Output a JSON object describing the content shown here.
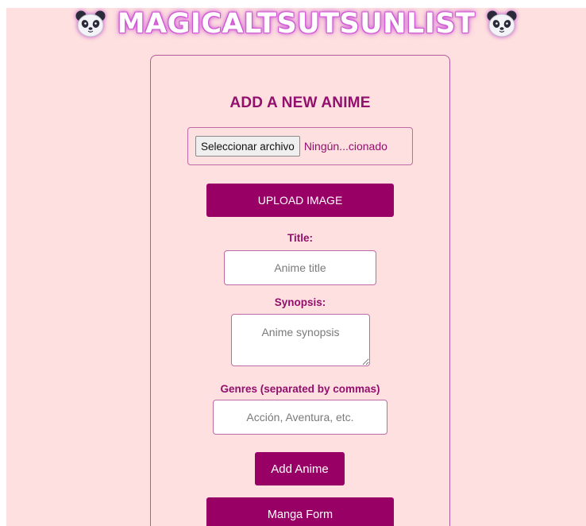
{
  "header": {
    "title": "MAGICALTSUTSUNLIST",
    "left_icon": "panda-icon",
    "right_icon": "panda-icon"
  },
  "form": {
    "heading": "ADD A NEW ANIME",
    "file_input": {
      "button_label": "Seleccionar archivo",
      "status": "Ningún...cionado"
    },
    "upload_label": "UPLOAD IMAGE",
    "title_label": "Title:",
    "title_placeholder": "Anime title",
    "synopsis_label": "Synopsis:",
    "synopsis_placeholder": "Anime synopsis",
    "genres_label": "Genres (separated by commas)",
    "genres_placeholder": "Acción, Aventura, etc.",
    "add_label": "Add Anime",
    "manga_label": "Manga Form"
  },
  "colors": {
    "background": "#fde0df",
    "accent": "#990066",
    "text_accent": "#930f6d",
    "border": "#c06aa6"
  }
}
